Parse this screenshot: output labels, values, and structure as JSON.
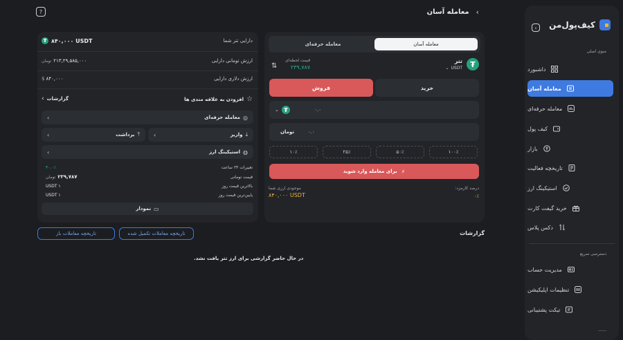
{
  "header": {
    "title": "معامله آسان"
  },
  "sidebar": {
    "logo_text": "کیف‌پول‌من",
    "section_menu": "منوی اصلی",
    "items": [
      {
        "label": "داشبورد"
      },
      {
        "label": "معامله آسان"
      },
      {
        "label": "معامله حرفه‌ای"
      },
      {
        "label": "کیف پول"
      },
      {
        "label": "بازار"
      },
      {
        "label": "تاریخچه فعالیت"
      },
      {
        "label": "استیکینگ ارز"
      },
      {
        "label": "خرید گیفت کارت"
      },
      {
        "label": "دکس پلاس"
      }
    ],
    "section_quick": "دسترسی سریع",
    "quick_items": [
      {
        "label": "مدیریت حساب"
      },
      {
        "label": "تنظیمات اپلیکیشن"
      },
      {
        "label": "تیکت پشتیبانی"
      }
    ]
  },
  "trade": {
    "tabs": {
      "easy": "معامله آسان",
      "pro": "معامله حرفه‌ای"
    },
    "coin": {
      "name": "تتر",
      "symbol": "USDT",
      "price_label": "قیمت لحظه‌ای",
      "price": "۲۳۹,۷۸۷"
    },
    "buy_label": "خرید",
    "sell_label": "فروش",
    "amount_value": "۰.۰",
    "toman_label": "تومان",
    "toman_value": "۰.۰",
    "percents": [
      "۱۰۰٪",
      "۵۰٪",
      "۲۵٪",
      "۱۰٪"
    ],
    "login_button": "برای معامله وارد شوید",
    "balance_label": "موجودی ارزی شما",
    "balance_value": "۸۴۰,۰۰۰ USDT",
    "fee_label": "درصد کارمزد:",
    "fee_value": "۰٪"
  },
  "asset": {
    "title": "دارایی تتر شما",
    "amount": "۸۴۰,۰۰۰ USDT",
    "toman_label": "ارزش تومانی دارایی",
    "toman_value": "۲۱۳,۲۹,۵۸۵,۰۰۰",
    "toman_unit": "تومان",
    "dollar_label": "ارزش دلاری دارایی",
    "dollar_value": "۸۴۰,۰۰۰"
  },
  "favorites": {
    "label": "افزودن به علاقه مندی ها",
    "reports": "گزارشات"
  },
  "actions": {
    "pro_trade": "معامله حرفه‌ای",
    "deposit": "واریز",
    "withdraw": "برداشت",
    "staking": "استیکینگ ارز"
  },
  "stats": [
    {
      "label": "تغییرات ۲۴ ساعت",
      "value": "۴۰.۰٪"
    },
    {
      "label": "قیمت تومانی",
      "value": "۲۳۹,۷۸۷",
      "unit": "تومان"
    },
    {
      "label": "بالاترین قیمت روز",
      "value": "USDT ۱"
    },
    {
      "label": "پایین‌ترین قیمت روز",
      "value": "USDT ۱"
    }
  ],
  "chart_button": "نمودار",
  "reports": {
    "title": "گزارشات",
    "tab_completed": "تاریخچه معاملات تکمیل شده",
    "tab_open": "تاریخچه معاملات باز",
    "empty": "در حال حاضر گزارشی برای ارز تتر یافت نشد."
  }
}
